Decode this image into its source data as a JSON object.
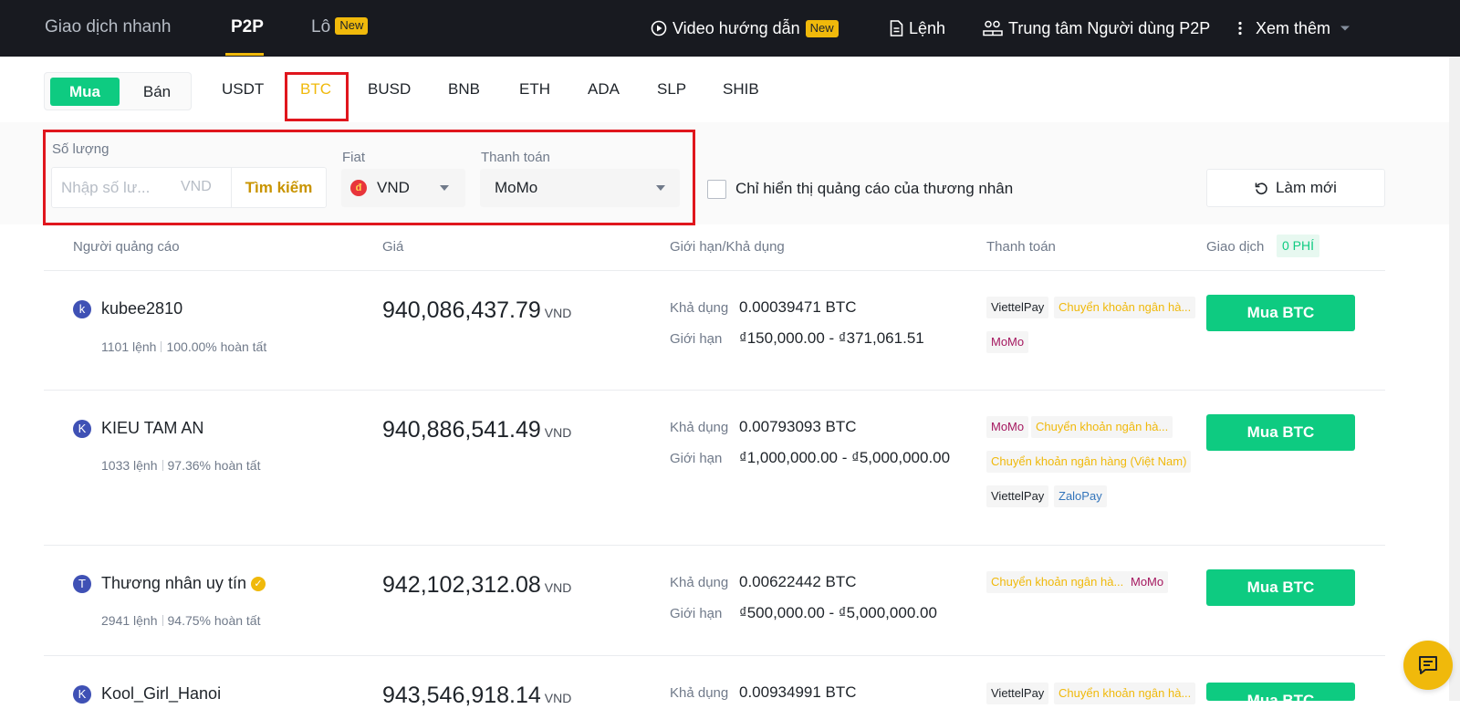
{
  "topnav": {
    "express": "Giao dịch nhanh",
    "p2p": "P2P",
    "block": "Lô",
    "new_badge": "New",
    "video": "Video hướng dẫn",
    "orders": "Lệnh",
    "user_center": "Trung tâm Người dùng P2P",
    "more": "Xem thêm"
  },
  "trade_toggle": {
    "buy": "Mua",
    "sell": "Bán"
  },
  "assets": [
    "USDT",
    "BTC",
    "BUSD",
    "BNB",
    "ETH",
    "ADA",
    "SLP",
    "SHIB"
  ],
  "selected_asset": "BTC",
  "filters": {
    "amount_label": "Số lượng",
    "amount_placeholder": "Nhập số lư...",
    "amount_unit": "VND",
    "search": "Tìm kiếm",
    "fiat_label": "Fiat",
    "fiat_icon": "đ",
    "fiat_value": "VND",
    "payment_label": "Thanh toán",
    "payment_value": "MoMo",
    "merchant_only": "Chỉ hiển thị quảng cáo của thương nhân",
    "refresh": "Làm mới"
  },
  "table": {
    "headers": {
      "advertiser": "Người quảng cáo",
      "price": "Giá",
      "limit": "Giới hạn/Khả dụng",
      "payment": "Thanh toán",
      "trade": "Giao dịch",
      "fee": "0 PHÍ"
    },
    "available_label": "Khả dụng",
    "limit_label": "Giới hạn",
    "rows": [
      {
        "initial": "k",
        "name": "kubee2810",
        "orders": "1101 lệnh",
        "completion": "100.00% hoàn tất",
        "price": "940,086,437.79",
        "currency": "VND",
        "available": "0.00039471 BTC",
        "limit": "₫150,000.00 - ₫371,061.51",
        "payments": [
          "ViettelPay",
          "Chuyển khoản ngân hà...",
          "MoMo"
        ],
        "buy": "Mua BTC"
      },
      {
        "initial": "K",
        "name": "KIEU TAM AN",
        "orders": "1033 lệnh",
        "completion": "97.36% hoàn tất",
        "price": "940,886,541.49",
        "currency": "VND",
        "available": "0.00793093 BTC",
        "limit": "₫1,000,000.00 - ₫5,000,000.00",
        "payments": [
          "MoMo",
          "Chuyển khoản ngân hà...",
          "Chuyển khoản ngân hàng (Việt Nam)",
          "ViettelPay",
          "ZaloPay"
        ],
        "buy": "Mua BTC"
      },
      {
        "initial": "T",
        "name": "Thương nhân uy tín",
        "orders": "2941 lệnh",
        "completion": "94.75% hoàn tất",
        "price": "942,102,312.08",
        "currency": "VND",
        "available": "0.00622442 BTC",
        "limit": "₫500,000.00 - ₫5,000,000.00",
        "payments": [
          "Chuyển khoản ngân hà...",
          "MoMo"
        ],
        "buy": "Mua BTC"
      },
      {
        "initial": "K",
        "name": "Kool_Girl_Hanoi",
        "price": "943,546,918.14",
        "currency": "VND",
        "available": "0.00934991 BTC",
        "payments": [
          "ViettelPay",
          "Chuyển khoản ngân hà..."
        ],
        "buy": "Mua BTC"
      }
    ]
  },
  "colors": {
    "buy_green": "#0ecb81",
    "accent_yellow": "#f0b90b",
    "highlight_red": "#e0161d",
    "nav_bg": "#181a20"
  },
  "icons": {
    "video": "play-circle-icon",
    "orders": "document-icon",
    "user_center": "users-icon",
    "more": "dots-vertical-icon",
    "refresh": "refresh-icon",
    "chat": "chat-icon"
  }
}
